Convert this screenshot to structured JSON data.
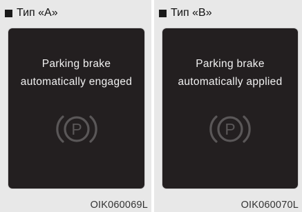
{
  "panels": [
    {
      "type_label": "Тип «A»",
      "message_line1": "Parking brake",
      "message_line2": "automatically engaged",
      "icon_letter": "P",
      "code": "OIK060069L"
    },
    {
      "type_label": "Тип «B»",
      "message_line1": "Parking brake",
      "message_line2": "automatically applied",
      "icon_letter": "P",
      "code": "OIK060070L"
    }
  ],
  "icons": [
    "parking-brake-icon"
  ],
  "colors": {
    "screen_bg": "#231f20",
    "icon": "#5a5758",
    "text": "#f2f2f2",
    "panel_bg": "#e8e8e8"
  }
}
